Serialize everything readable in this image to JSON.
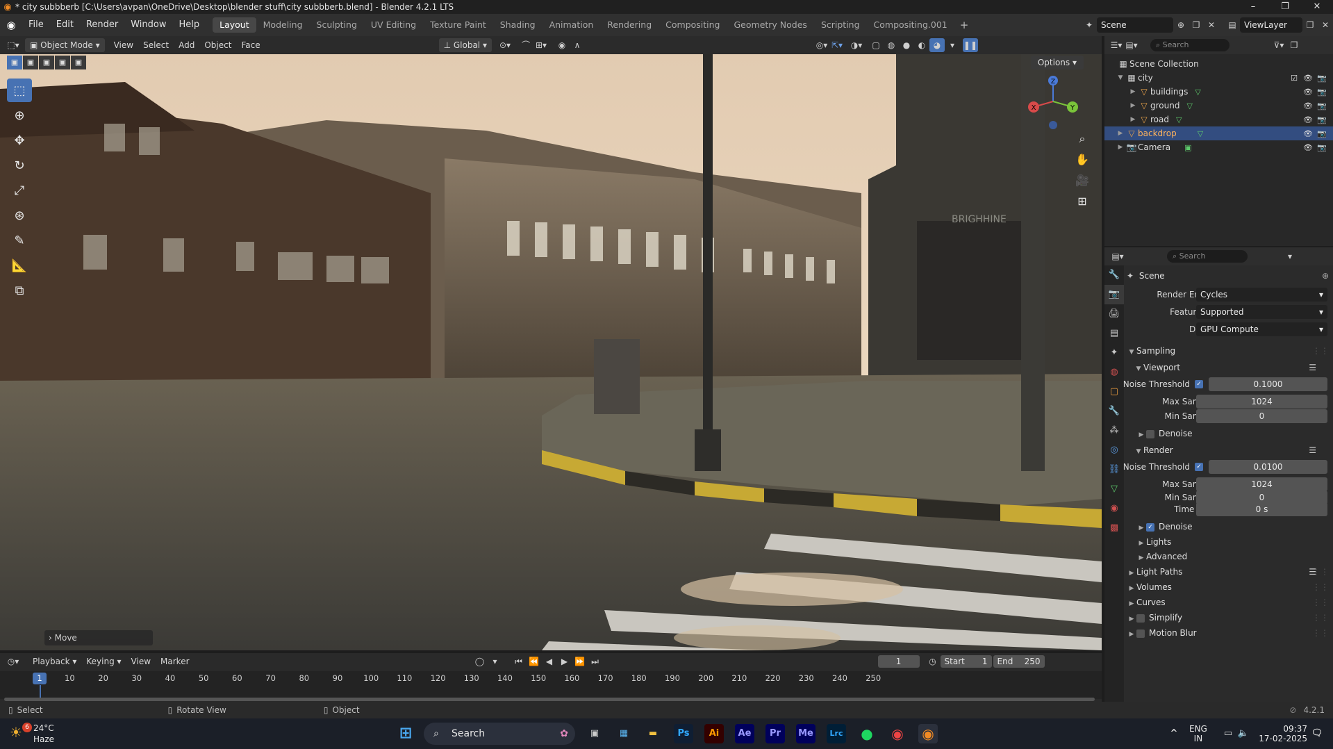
{
  "window": {
    "title": "* city subbberb [C:\\Users\\avpan\\OneDrive\\Desktop\\blender stuff\\city subbberb.blend] - Blender 4.2.1 LTS",
    "logo_icon": "blender-logo-icon",
    "minimize": "–",
    "maximize": "❐",
    "close": "✕"
  },
  "menu": {
    "items": [
      "File",
      "Edit",
      "Render",
      "Window",
      "Help"
    ]
  },
  "workspaces": {
    "tabs": [
      "Layout",
      "Modeling",
      "Sculpting",
      "UV Editing",
      "Texture Paint",
      "Shading",
      "Animation",
      "Rendering",
      "Compositing",
      "Geometry Nodes",
      "Scripting",
      "Compositing.001"
    ],
    "active": "Layout",
    "add": "+"
  },
  "scene_selector": {
    "scene": "Scene",
    "view_layer": "ViewLayer"
  },
  "viewport_header": {
    "mode": "Object Mode",
    "menus": [
      "View",
      "Select",
      "Add",
      "Object",
      "Face"
    ],
    "transform_orientation": "Global",
    "options": "Options"
  },
  "viewport": {
    "operator_panel": "Move",
    "gizmo": {
      "z": "Z",
      "x": "X",
      "y": "Y"
    },
    "shop_sign": "BRIGHHINE"
  },
  "outliner": {
    "search_placeholder": "Search",
    "root": "Scene Collection",
    "collection": "city",
    "items": [
      {
        "name": "buildings"
      },
      {
        "name": "ground"
      },
      {
        "name": "road"
      },
      {
        "name": "backdrop",
        "selected": true
      },
      {
        "name": "Camera"
      }
    ]
  },
  "properties": {
    "search_placeholder": "Search",
    "context": "Scene",
    "render_engine_label": "Render Engine",
    "render_engine": "Cycles",
    "feature_set_label": "Feature Set",
    "feature_set": "Supported",
    "device_label": "Device",
    "device": "GPU Compute",
    "sampling": "Sampling",
    "viewport": "Viewport",
    "noise_threshold_label": "Noise Threshold",
    "vp_noise_threshold": "0.1000",
    "max_samples_label": "Max Samples",
    "vp_max_samples": "1024",
    "min_samples_label": "Min Samples",
    "vp_min_samples": "0",
    "denoise": "Denoise",
    "render": "Render",
    "r_noise_threshold": "0.0100",
    "r_max_samples": "1024",
    "r_min_samples": "0",
    "time_limit_label": "Time Limit",
    "time_limit": "0 s",
    "lights": "Lights",
    "advanced": "Advanced",
    "light_paths": "Light Paths",
    "volumes": "Volumes",
    "curves": "Curves",
    "simplify": "Simplify",
    "motion_blur": "Motion Blur"
  },
  "timeline": {
    "menus": [
      "Playback",
      "Keying",
      "View",
      "Marker"
    ],
    "current_frame": "1",
    "start_label": "Start",
    "start": "1",
    "end_label": "End",
    "end": "250",
    "ticks": [
      "1",
      "10",
      "20",
      "30",
      "40",
      "50",
      "60",
      "70",
      "80",
      "90",
      "100",
      "110",
      "120",
      "130",
      "140",
      "150",
      "160",
      "170",
      "180",
      "190",
      "200",
      "210",
      "220",
      "230",
      "240",
      "250"
    ]
  },
  "statusbar": {
    "select": "Select",
    "rotate_view": "Rotate View",
    "object": "Object",
    "version": "4.2.1"
  },
  "taskbar": {
    "weather_temp": "24°C",
    "weather_desc": "Haze",
    "weather_badge": "6",
    "search": "Search",
    "apps": [
      "Ps",
      "Ai",
      "Ae",
      "Pr",
      "Me",
      "Lrc"
    ],
    "lang1": "ENG",
    "lang2": "IN",
    "time": "09:37",
    "date": "17-02-2025"
  }
}
